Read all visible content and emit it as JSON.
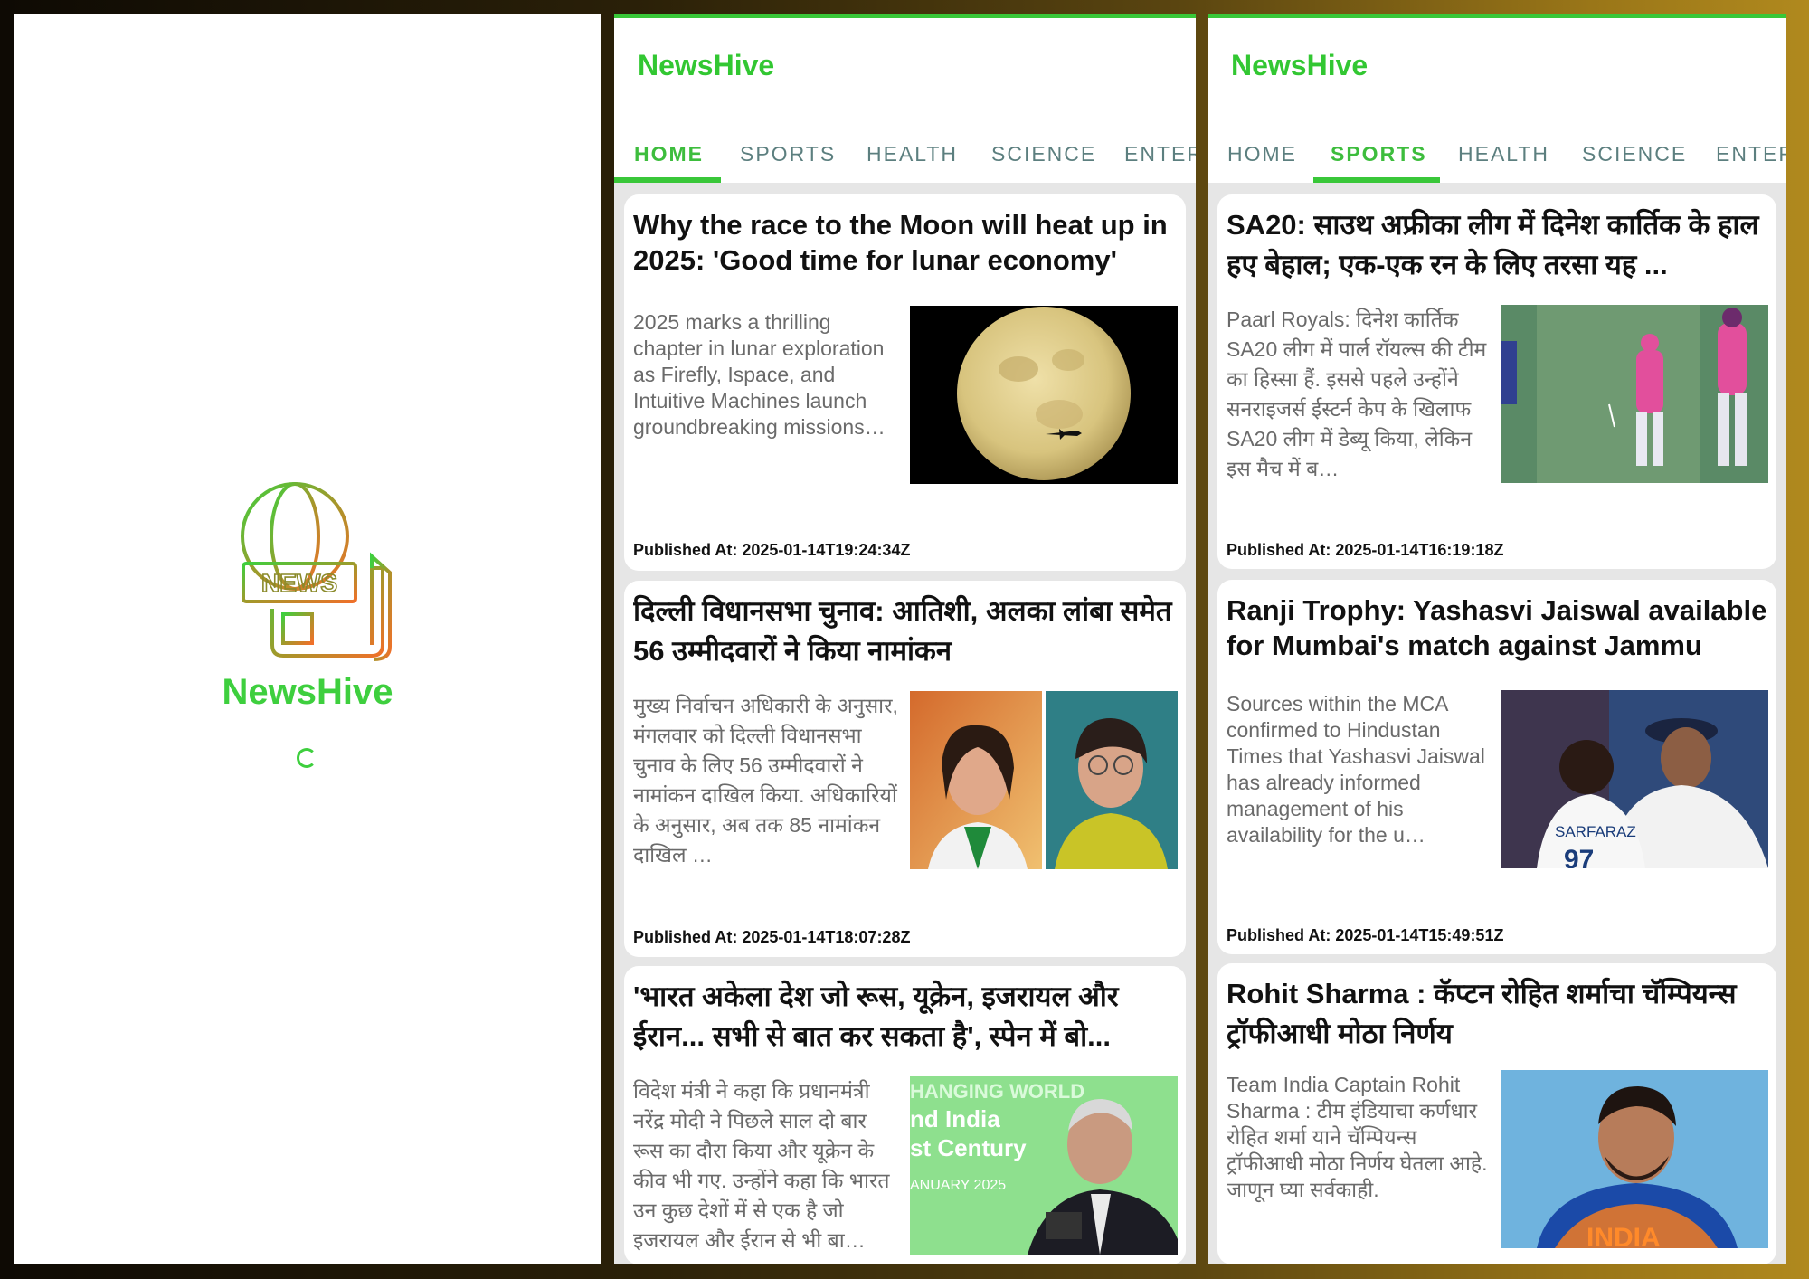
{
  "app_name": "NewsHive",
  "splash": {
    "title": "NewsHive",
    "logo_text": "NEWS"
  },
  "tabs": [
    "HOME",
    "SPORTS",
    "HEALTH",
    "SCIENCE",
    "ENTER"
  ],
  "date_prefix": "Published At: ",
  "home": {
    "active_tab": "HOME",
    "articles": [
      {
        "title": "Why the race to the Moon will heat up in 2025: 'Good time for lunar economy'",
        "description": "2025 marks a thrilling chapter in lunar exploration as Firefly, Ispace, and Intuitive Machines launch groundbreaking missions…",
        "published": "Published At: 2025-01-14T19:24:34Z"
      },
      {
        "title": "दिल्ली विधानसभा चुनाव: आतिशी, अलका लांबा समेत 56 उम्मीदवारों ने किया नामांकन",
        "description": "मुख्य निर्वाचन अधिकारी के अनुसार, मंगलवार को दिल्ली विधानसभा चुनाव के लिए 56 उम्मीदवारों ने नामांकन दाखिल किया. अधिकारियों के अनुसार, अब तक 85 नामांकन दाखिल …",
        "published": "Published At: 2025-01-14T18:07:28Z"
      },
      {
        "title": "'भारत अकेला देश जो रूस, यूक्रेन, इजरायल और ईरान... सभी से बात कर सकता है', स्पेन में बो...",
        "description": "विदेश मंत्री ने कहा कि प्रधानमंत्री नरेंद्र मोदी ने पिछले साल दो बार रूस का दौरा किया और यूक्रेन के कीव भी गए. उन्होंने कहा कि भारत उन कुछ देशों में से एक है जो इजरायल और ईरान से भी बा…",
        "published": "",
        "image_text": [
          "HANGING WORLD",
          "nd India",
          "st Century",
          "ANUARY 2025"
        ]
      }
    ]
  },
  "sports": {
    "active_tab": "SPORTS",
    "articles": [
      {
        "title": "SA20: साउथ अफ्रीका लीग में दिनेश कार्तिक के हाल हए बेहाल; एक-एक रन के लिए तरसा यह ...",
        "description": "Paarl Royals: दिनेश कार्तिक SA20 लीग में पार्ल रॉयल्स की टीम का हिस्सा हैं. इससे पहले उन्होंने सनराइजर्स ईस्टर्न केप के खिलाफ SA20 लीग में डेब्यू किया, लेकिन इस मैच में ब…",
        "published": "Published At: 2025-01-14T16:19:18Z"
      },
      {
        "title": "Ranji Trophy: Yashasvi Jaiswal available for Mumbai's match against Jammu an…",
        "description": "Sources within the MCA confirmed to Hindustan Times that Yashasvi Jaiswal has already informed management of his availability for the u…",
        "published": "Published At: 2025-01-14T15:49:51Z",
        "image_text": [
          "SARFARAZ",
          "97"
        ]
      },
      {
        "title": "Rohit Sharma : कॅप्टन रोहित शर्माचा चॅम्पियन्स ट्रॉफीआधी मोठा निर्णय",
        "description": "Team India Captain Rohit Sharma : टीम इंडियाचा कर्णधार रोहित शर्मा याने चॅम्पियन्स ट्रॉफीआधी मोठा निर्णय घेतला आहे. जाणून घ्या सर्वकाही.",
        "published": "",
        "image_text": [
          "INDIA"
        ]
      }
    ]
  },
  "colors": {
    "brand_green": "#3ecf3e",
    "tab_inactive": "#5c7f7f",
    "text_dark": "#111111",
    "text_muted": "#6a6a6a"
  },
  "icons": [
    "news-globe-logo-icon",
    "loading-spinner-icon"
  ]
}
